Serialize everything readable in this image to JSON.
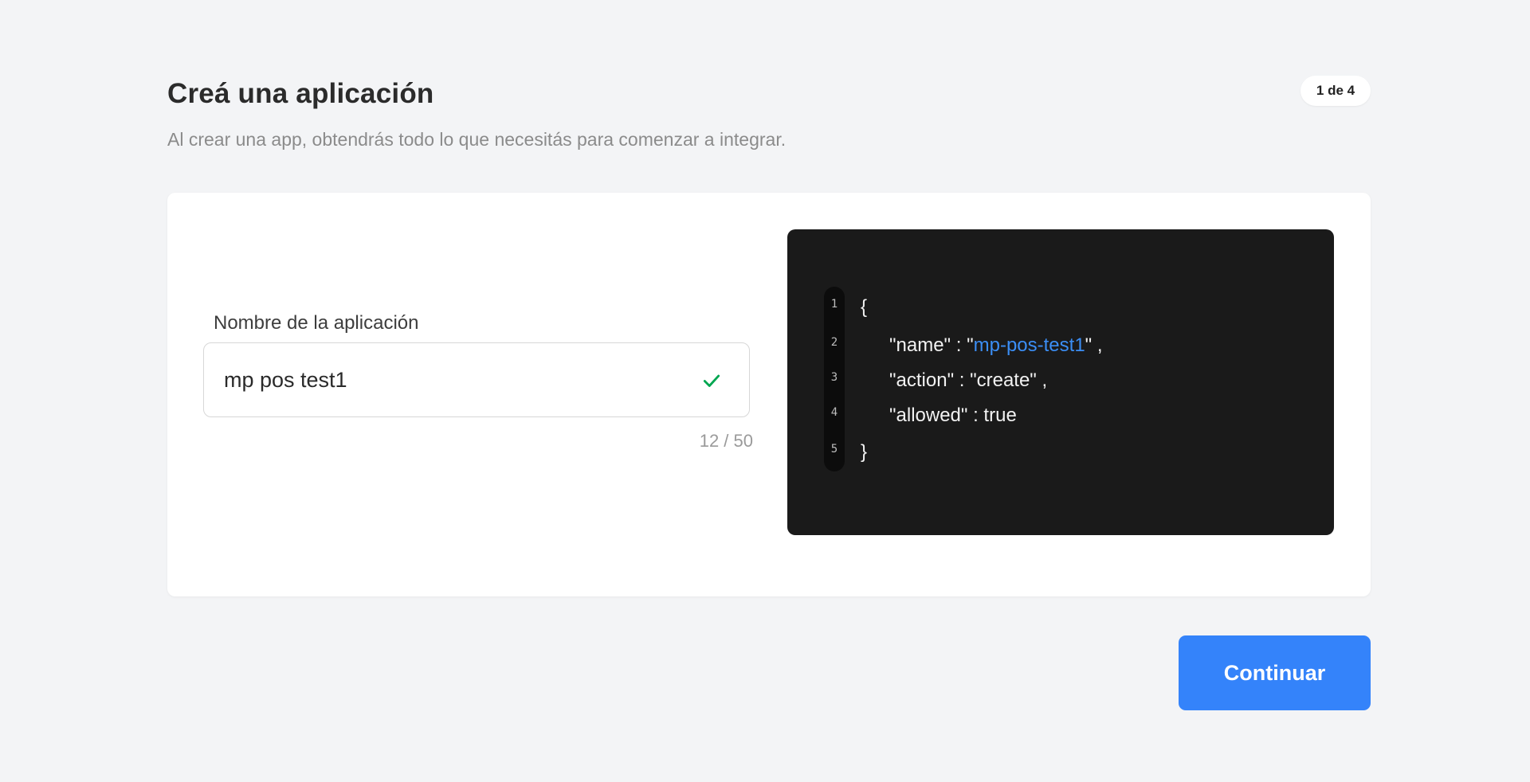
{
  "header": {
    "title": "Creá una aplicación",
    "subtitle": "Al crear una app, obtendrás todo lo que necesitás para comenzar a integrar.",
    "step_indicator": "1 de 4"
  },
  "form": {
    "app_name_label": "Nombre de la aplicación",
    "app_name_value": "mp pos test1",
    "char_counter": "12 / 50",
    "valid_icon": "check-icon"
  },
  "code_preview": {
    "line_numbers": [
      "1",
      "2",
      "3",
      "4",
      "5"
    ],
    "open_brace": "{",
    "name_key": "\"name\" : \"",
    "name_value": "mp-pos-test1",
    "name_suffix": "\" ,",
    "action_line": "\"action\" : \"create\" ,",
    "allowed_line": "\"allowed\" : true",
    "close_brace": "}"
  },
  "footer": {
    "continue_label": "Continuar"
  },
  "colors": {
    "background": "#f3f4f6",
    "primary": "#3483fa",
    "code_background": "#1a1a1a",
    "code_accent": "#3b8ef5",
    "valid": "#00a650"
  }
}
